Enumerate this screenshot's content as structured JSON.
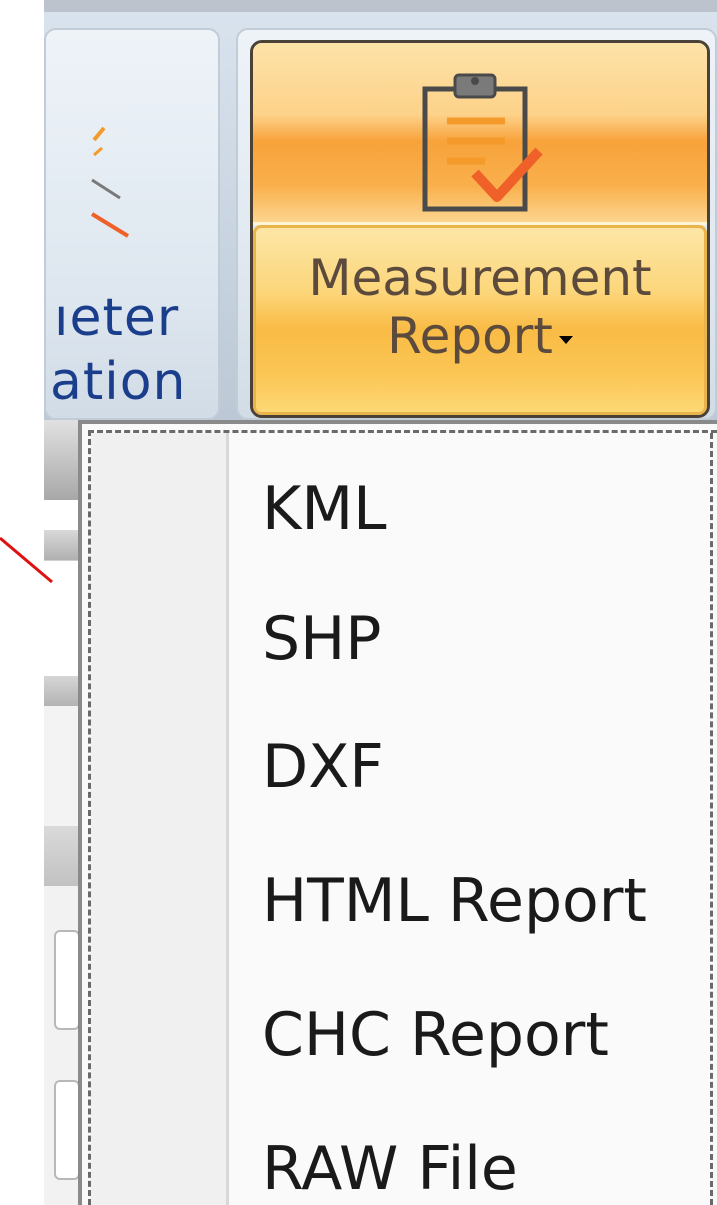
{
  "ribbon": {
    "param_button": {
      "label_line1": "ıeter",
      "label_line2": "ation"
    },
    "measurement_report_button": {
      "label_line1": "Measurement",
      "label_line2": "Report",
      "icon": "clipboard-check-icon"
    }
  },
  "dropdown_menu": {
    "items": [
      "KML",
      "SHP",
      "DXF",
      "HTML Report",
      "CHC Report",
      "RAW File"
    ]
  },
  "colors": {
    "accent_orange": "#f8a23a",
    "label_blue": "#1a3e8c",
    "annotation_red": "#e01010"
  }
}
